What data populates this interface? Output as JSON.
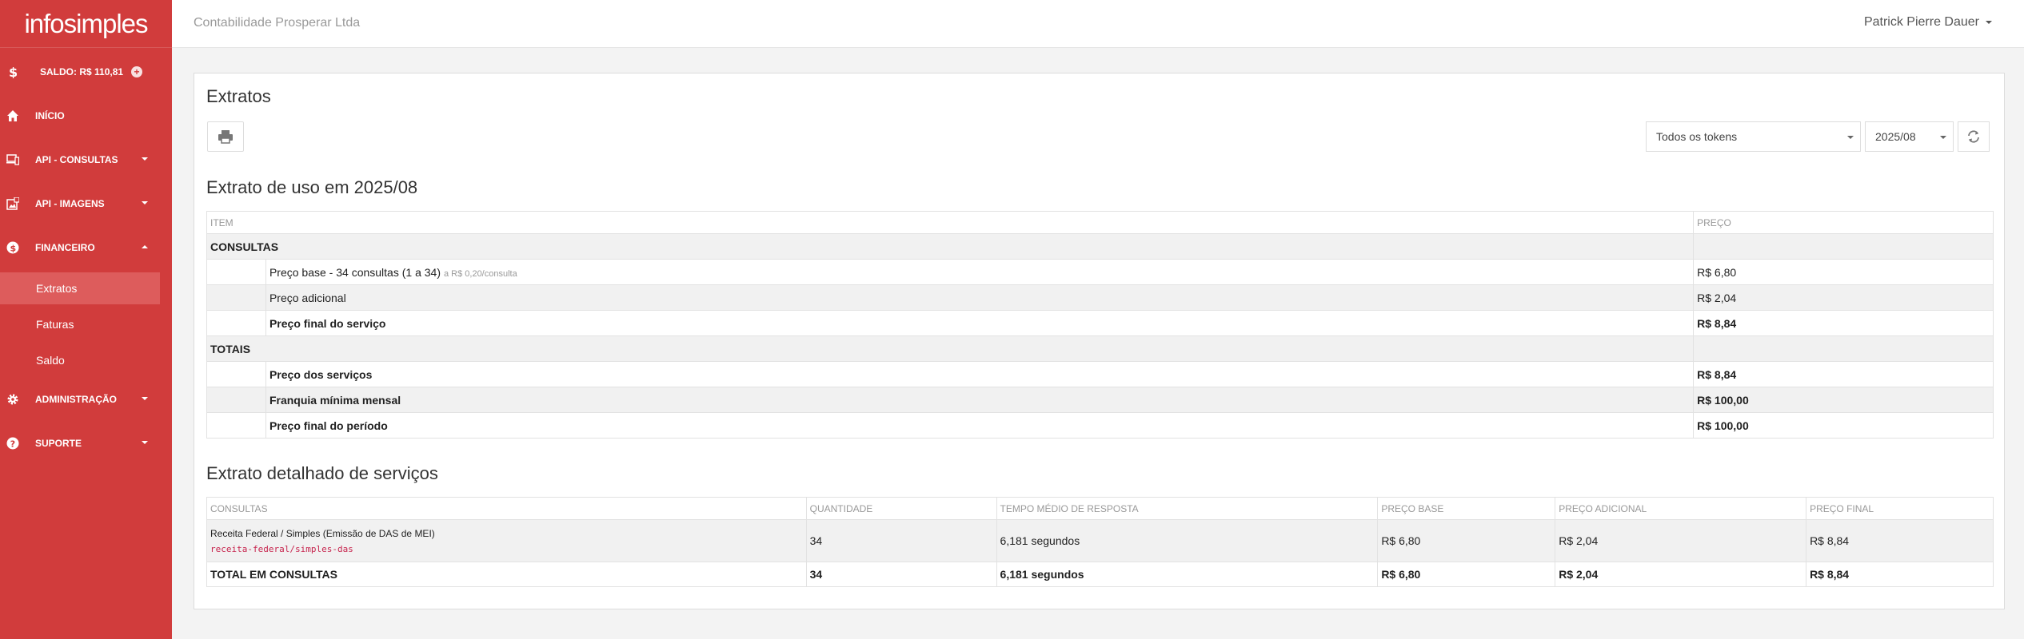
{
  "sidebar": {
    "logo": "infosimples",
    "balance": "SALDO: R$ 110,81",
    "items": [
      {
        "label": "INÍCIO"
      },
      {
        "label": "API - CONSULTAS"
      },
      {
        "label": "API - IMAGENS"
      },
      {
        "label": "FINANCEIRO"
      },
      {
        "label": "ADMINISTRAÇÃO"
      },
      {
        "label": "SUPORTE"
      }
    ],
    "sub_items": [
      {
        "label": "Extratos"
      },
      {
        "label": "Faturas"
      },
      {
        "label": "Saldo"
      }
    ]
  },
  "topbar": {
    "company": "Contabilidade Prosperar Ltda",
    "user": "Patrick Pierre Dauer"
  },
  "panel": {
    "title": "Extratos",
    "token_select": "Todos os tokens",
    "period_select": "2025/08"
  },
  "usage": {
    "title": "Extrato de uso em 2025/08",
    "headers": [
      "ITEM",
      "PREÇO"
    ],
    "rows": [
      {
        "group": "CONSULTAS"
      },
      {
        "label": "Preço base - 34 consultas (1 a 34)",
        "note": "a R$ 0,20/consulta",
        "price": "R$ 6,80"
      },
      {
        "label": "Preço adicional",
        "price": "R$ 2,04"
      },
      {
        "label": "Preço final do serviço",
        "price": "R$ 8,84"
      },
      {
        "group": "TOTAIS"
      },
      {
        "label": "Preço dos serviços",
        "price": "R$ 8,84"
      },
      {
        "label": "Franquia mínima mensal",
        "price": "R$ 100,00"
      },
      {
        "label": "Preço final do período",
        "price": "R$ 100,00"
      }
    ]
  },
  "detail": {
    "title": "Extrato detalhado de serviços",
    "headers": [
      "CONSULTAS",
      "QUANTIDADE",
      "TEMPO MÉDIO DE RESPOSTA",
      "PREÇO BASE",
      "PREÇO ADICIONAL",
      "PREÇO FINAL"
    ],
    "row": {
      "service": "Receita Federal / Simples (Emissão de DAS de MEI)",
      "code": "receita-federal/simples-das",
      "qty": "34",
      "time": "6,181 segundos",
      "base": "R$ 6,80",
      "additional": "R$ 2,04",
      "final": "R$ 8,84"
    },
    "total": {
      "label": "TOTAL EM CONSULTAS",
      "qty": "34",
      "time": "6,181 segundos",
      "base": "R$ 6,80",
      "additional": "R$ 2,04",
      "final": "R$ 8,84"
    }
  }
}
